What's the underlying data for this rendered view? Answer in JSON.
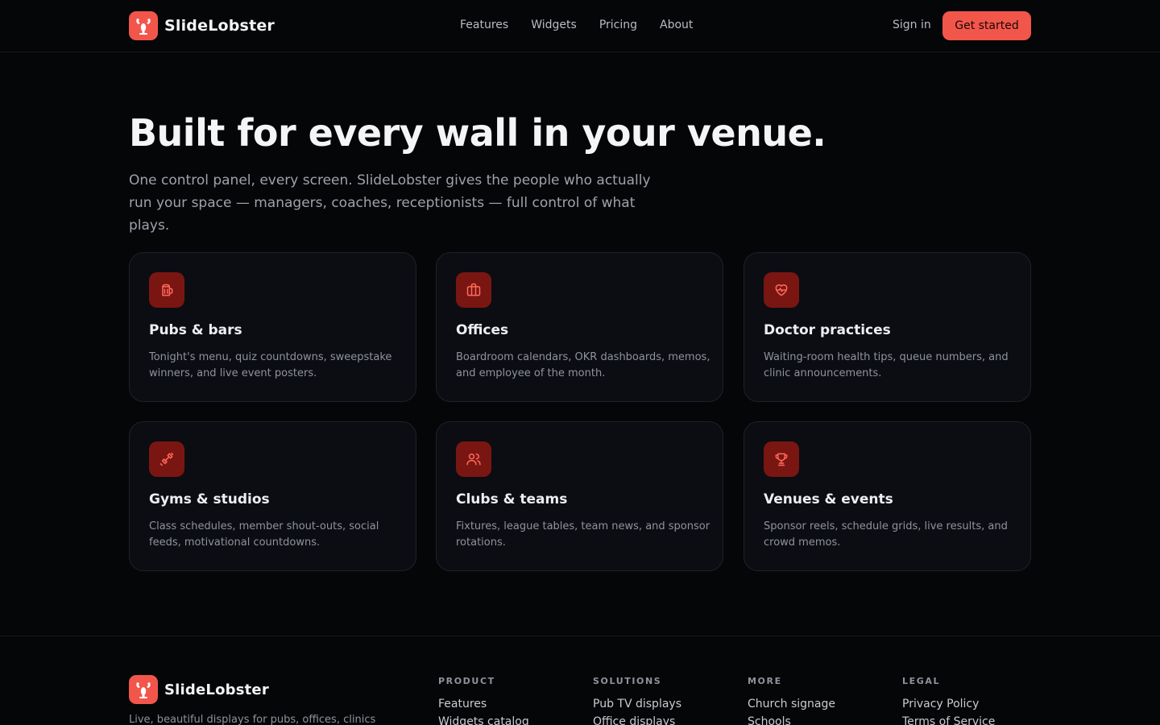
{
  "brand": {
    "name": "SlideLobster",
    "accent": "#f2564b",
    "icon": "lobster-logo-icon"
  },
  "nav": {
    "items": [
      "Features",
      "Widgets",
      "Pricing",
      "About"
    ],
    "signin_label": "Sign in",
    "cta_label": "Get started"
  },
  "hero": {
    "title": "Built for every wall in your venue.",
    "subtitle": "One control panel, every screen. SlideLobster gives the people who actually run your space — managers, coaches, receptionists — full control of what plays."
  },
  "cards": [
    {
      "icon": "beer-mug-icon",
      "title": "Pubs & bars",
      "desc": "Tonight's menu, quiz countdowns, sweepstake winners, and live event posters."
    },
    {
      "icon": "briefcase-icon",
      "title": "Offices",
      "desc": "Boardroom calendars, OKR dashboards, memos, and employee of the month."
    },
    {
      "icon": "heart-pulse-icon",
      "title": "Doctor practices",
      "desc": "Waiting-room health tips, queue numbers, and clinic announcements."
    },
    {
      "icon": "dumbbell-icon",
      "title": "Gyms & studios",
      "desc": "Class schedules, member shout-outs, social feeds, motivational countdowns."
    },
    {
      "icon": "users-icon",
      "title": "Clubs & teams",
      "desc": "Fixtures, league tables, team news, and sponsor rotations."
    },
    {
      "icon": "trophy-icon",
      "title": "Venues & events",
      "desc": "Sponsor reels, schedule grids, live results, and crowd memos."
    }
  ],
  "footer": {
    "brand_name": "SlideLobster",
    "tagline": "Live, beautiful displays for pubs, offices, clinics",
    "columns": [
      {
        "heading": "PRODUCT",
        "links": [
          "Features",
          "Widgets catalog"
        ]
      },
      {
        "heading": "SOLUTIONS",
        "links": [
          "Pub TV displays",
          "Office displays"
        ]
      },
      {
        "heading": "MORE",
        "links": [
          "Church signage",
          "Schools"
        ]
      },
      {
        "heading": "LEGAL",
        "links": [
          "Privacy Policy",
          "Terms of Service"
        ]
      }
    ]
  }
}
